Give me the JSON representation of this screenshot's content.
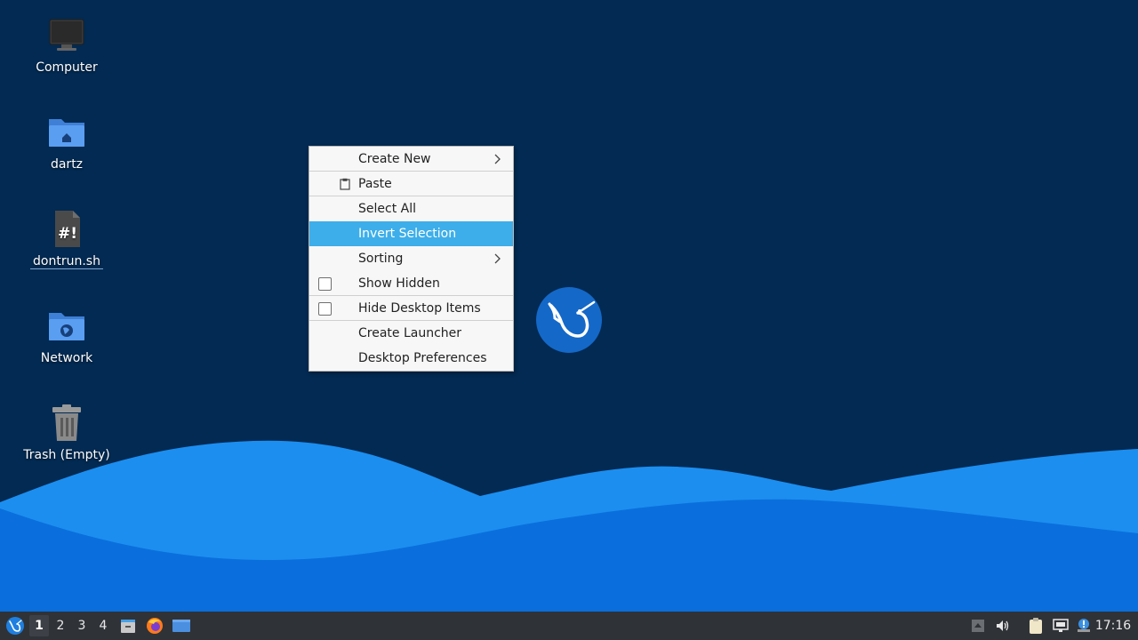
{
  "desktop": {
    "background": "#022a52",
    "icons": [
      {
        "name": "computer",
        "label": "Computer",
        "icon": "monitor-icon"
      },
      {
        "name": "home",
        "label": "dartz",
        "icon": "home-folder-icon"
      },
      {
        "name": "script",
        "label": "dontrun.sh",
        "icon": "script-file-icon"
      },
      {
        "name": "network",
        "label": "Network",
        "icon": "network-folder-icon"
      },
      {
        "name": "trash",
        "label": "Trash (Empty)",
        "icon": "trash-icon"
      }
    ]
  },
  "context_menu": {
    "items": [
      {
        "label": "Create New",
        "submenu": true
      },
      {
        "label": "Paste",
        "icon": "clipboard-icon"
      },
      {
        "label": "Select All"
      },
      {
        "label": "Invert Selection",
        "highlighted": true
      },
      {
        "label": "Sorting",
        "submenu": true
      },
      {
        "label": "Show Hidden",
        "checkbox": true,
        "checked": false
      },
      {
        "label": "Hide Desktop Items",
        "checkbox": true,
        "checked": false
      },
      {
        "label": "Create Launcher"
      },
      {
        "label": "Desktop Preferences"
      }
    ],
    "highlight_color": "#3daee9"
  },
  "taskbar": {
    "workspaces": [
      "1",
      "2",
      "3",
      "4"
    ],
    "active_workspace": "1",
    "launchers": [
      "file-manager-icon",
      "firefox-icon",
      "desktop-icon"
    ],
    "tray": [
      "tray-arrow-icon",
      "volume-icon",
      "clipboard-tray-icon",
      "network-tray-icon",
      "update-notifier-icon"
    ],
    "clock": "17:16",
    "background": "#2f3237"
  }
}
